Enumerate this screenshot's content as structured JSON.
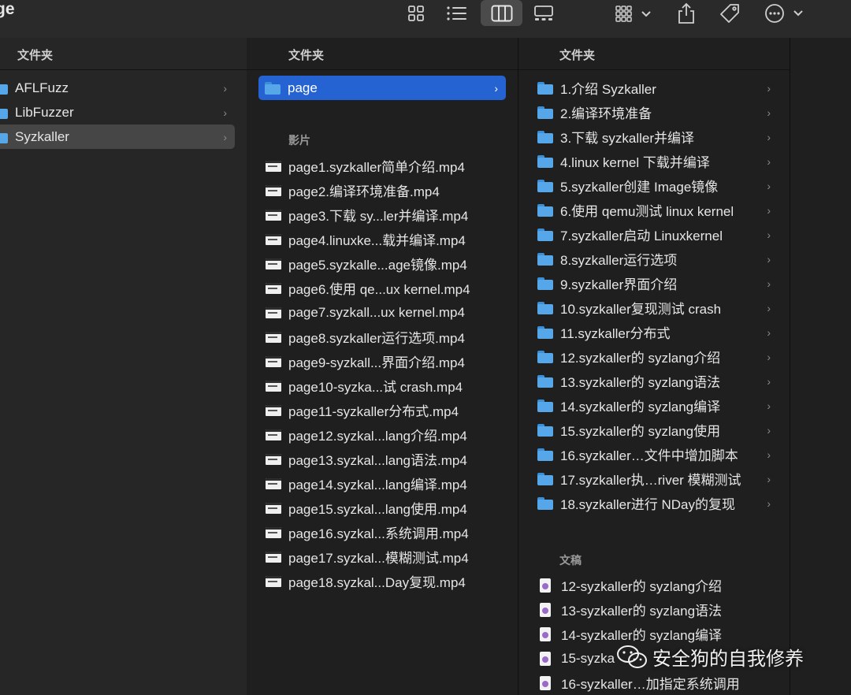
{
  "window": {
    "title": "ge"
  },
  "toolbar": {
    "icons": [
      "grid-view-icon",
      "list-view-icon",
      "column-view-icon",
      "gallery-view-icon",
      "group-icon",
      "share-icon",
      "tag-icon",
      "more-icon"
    ],
    "active_view": "column-view-icon"
  },
  "column1": {
    "header": "文件夹",
    "items": [
      {
        "label": "AFLFuzz",
        "selected": false
      },
      {
        "label": "LibFuzzer",
        "selected": false
      },
      {
        "label": "Syzkaller",
        "selected": true
      }
    ]
  },
  "column2": {
    "header": "文件夹",
    "folders": [
      {
        "label": "page",
        "selected": true
      }
    ],
    "movies_title": "影片",
    "movies": [
      "page1.syzkaller简单介绍.mp4",
      "page2.编译环境准备.mp4",
      "page3.下载 sy...ler并编译.mp4",
      "page4.linuxke...载并编译.mp4",
      "page5.syzkalle...age镜像.mp4",
      "page6.使用 qe...ux kernel.mp4",
      "page7.syzkall...ux kernel.mp4",
      "page8.syzkaller运行选项.mp4",
      "page9-syzkall...界面介绍.mp4",
      "page10-syzka...试 crash.mp4",
      "page11-syzkaller分布式.mp4",
      "page12.syzkal...lang介绍.mp4",
      "page13.syzkal...lang语法.mp4",
      "page14.syzkal...lang编译.mp4",
      "page15.syzkal...lang使用.mp4",
      "page16.syzkal...系统调用.mp4",
      "page17.syzkal...模糊测试.mp4",
      "page18.syzkal...Day复现.mp4"
    ]
  },
  "column3": {
    "header": "文件夹",
    "folders": [
      "1.介绍 Syzkaller",
      "2.编译环境准备",
      "3.下载 syzkaller并编译",
      "4.linux kernel 下载并编译",
      "5.syzkaller创建 Image镜像",
      "6.使用 qemu测试 linux kernel",
      "7.syzkaller启动 Linuxkernel",
      "8.syzkaller运行选项",
      "9.syzkaller界面介绍",
      "10.syzkaller复现测试 crash",
      "11.syzkaller分布式",
      "12.syzkaller的 syzlang介绍",
      "13.syzkaller的 syzlang语法",
      "14.syzkaller的 syzlang编译",
      "15.syzkaller的 syzlang使用",
      "16.syzkaller…文件中增加脚本",
      "17.syzkaller执…river 模糊测试",
      "18.syzkaller进行 NDay的复现"
    ],
    "docs_title": "文稿",
    "docs": [
      "12-syzkaller的 syzlang介绍",
      "13-syzkaller的 syzlang语法",
      "14-syzkaller的 syzlang编译",
      "15-syzka",
      "16-syzkaller…加指定系统调用"
    ]
  },
  "watermark": {
    "text": "安全狗的自我修养"
  },
  "colors": {
    "selection_blue": "#2463d1",
    "folder_blue": "#56a7ea",
    "selection_gray": "#464646"
  }
}
